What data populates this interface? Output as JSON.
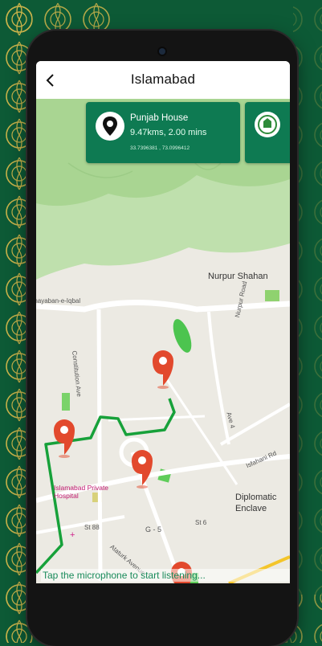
{
  "header": {
    "title": "Islamabad"
  },
  "cards": [
    {
      "name": "Punjab House",
      "distance": "9.47kms, 2.00 mins",
      "coords": "33.7396381 , 73.0996412"
    }
  ],
  "map_labels": {
    "nurpur_shahan": "Nurpur Shahan",
    "khayaban": "Khayaban-e-Iqbal",
    "constitution": "Constitution Ave",
    "nurpur_road": "Nurpur Road",
    "ave4": "Ave 4",
    "isfahani": "Isfahani Rd",
    "hospital": "Islamabad Private Hospital",
    "diplomatic": "Diplomatic Enclave",
    "g5": "G - 5",
    "st88": "St 88",
    "st6": "St 6",
    "ataturk": "Ataturk Avenue"
  },
  "hint": "Tap the microphone to start listening...",
  "colors": {
    "primary": "#0e7a52",
    "route": "#17a13a",
    "marker": "#e2492d"
  }
}
